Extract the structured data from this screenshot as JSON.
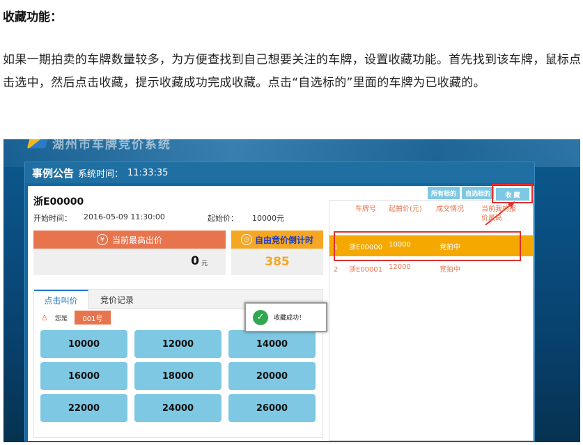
{
  "article": {
    "heading": "收藏功能：",
    "paragraph": "如果一期拍卖的车牌数量较多，为方便查找到自己想要关注的车牌，设置收藏功能。首先找到该车牌，鼠标点击选中，然后点击收藏，提示收藏成功完成收藏。点击“自选标的”里面的车牌为已收藏的。"
  },
  "app": {
    "brand": "湖州市车牌竞价系统",
    "panel_title": "事例公告",
    "time_label": "系统时间：",
    "time_value": "11:33:35"
  },
  "lot": {
    "plate": "浙E00000",
    "start_time_label": "开始时间：",
    "start_time_value": "2016-05-09 11:30:00",
    "start_price_label": "起始价：",
    "start_price_value": "10000元"
  },
  "highest_bid": {
    "label": "当前最高出价",
    "value": "0",
    "unit": "元"
  },
  "countdown": {
    "label": "自由竞价倒计时",
    "value": "385"
  },
  "tabs": [
    "点击叫价",
    "竞价记录"
  ],
  "user": {
    "label": "您是",
    "number": "001号"
  },
  "bid_buttons": [
    "10000",
    "12000",
    "14000",
    "16000",
    "18000",
    "20000",
    "22000",
    "24000",
    "26000"
  ],
  "toast": {
    "text": "收藏成功！"
  },
  "filters": {
    "all": "所有标的",
    "mine": "自选标的",
    "favorite": "收 藏"
  },
  "table": {
    "headers": [
      "车牌号",
      "起拍价(元)",
      "成交情况",
      "当前我的报价最高"
    ],
    "rows": [
      {
        "index": "1",
        "plate": "浙E00000",
        "price": "10000",
        "status": "竞拍中",
        "selected": true
      },
      {
        "index": "2",
        "plate": "浙E00001",
        "price": "12000",
        "status": "竞拍中",
        "selected": false
      }
    ]
  },
  "colors": {
    "accent_orange": "#e8744e",
    "accent_gold": "#f5a623",
    "button_blue": "#7ec8e3",
    "highlight_red": "#e03030"
  }
}
